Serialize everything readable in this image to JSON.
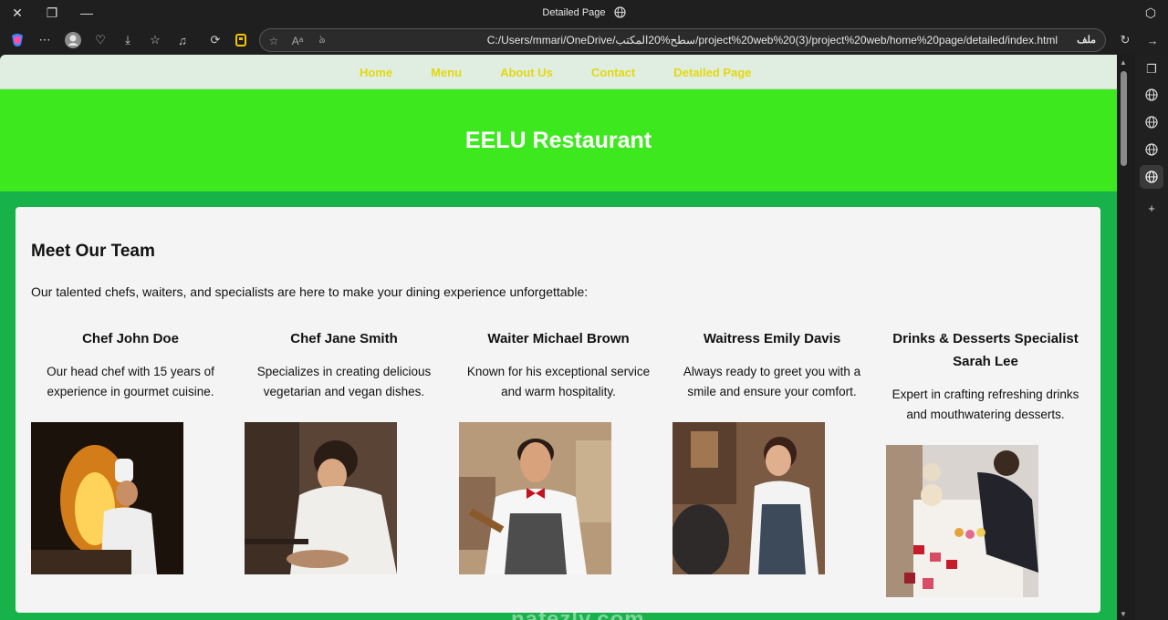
{
  "window": {
    "title": "Detailed Page"
  },
  "addressbar": {
    "url": "C:/Users/mmari/OneDrive/سطح%20المكتب/project%20web%20(3)/project%20web/home%20page/detailed/index.html",
    "file_label": "ملف"
  },
  "nav": {
    "items": [
      "Home",
      "Menu",
      "About Us",
      "Contact",
      "Detailed Page"
    ]
  },
  "hero": {
    "title": "EELU Restaurant"
  },
  "team": {
    "heading": "Meet Our Team",
    "intro": "Our talented chefs, waiters, and specialists are here to make your dining experience unforgettable:",
    "members": [
      {
        "name": "Chef John Doe",
        "desc": "Our head chef with 15 years of experience in gourmet cuisine."
      },
      {
        "name": "Chef Jane Smith",
        "desc": "Specializes in creating delicious vegetarian and vegan dishes."
      },
      {
        "name": "Waiter Michael Brown",
        "desc": "Known for his exceptional service and warm hospitality."
      },
      {
        "name": "Waitress Emily Davis",
        "desc": "Always ready to greet you with a smile and ensure your comfort."
      },
      {
        "name": "Drinks & Desserts Specialist Sarah Lee",
        "desc": "Expert in crafting refreshing drinks and mouthwatering desserts."
      }
    ]
  },
  "watermark": "nafezly.com",
  "colors": {
    "page_bg": "#17b249",
    "hero_bg": "#3ee81e",
    "nav_bg": "#dfeee0",
    "nav_link": "#e4d80f",
    "card_bg": "#f4f4f4"
  }
}
